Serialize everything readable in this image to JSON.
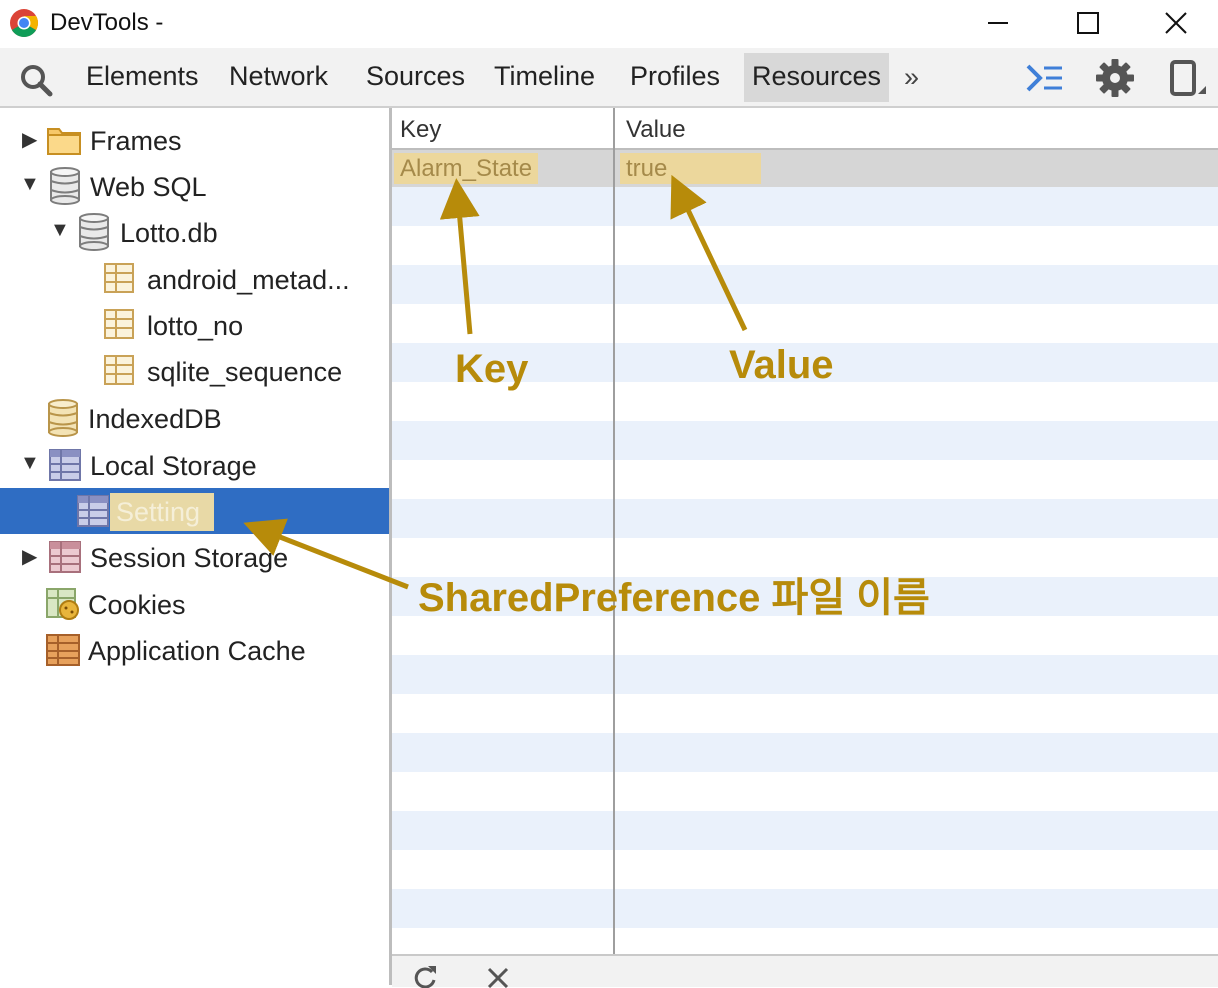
{
  "window": {
    "title": "DevTools -"
  },
  "toolbar": {
    "tabs": [
      "Elements",
      "Network",
      "Sources",
      "Timeline",
      "Profiles",
      "Resources"
    ],
    "active_tab": "Resources",
    "overflow_label": "»"
  },
  "sidebar": {
    "items": [
      {
        "label": "Frames",
        "icon": "folder-icon"
      },
      {
        "label": "Web SQL",
        "icon": "database-icon"
      },
      {
        "label": "Lotto.db",
        "icon": "database-icon"
      },
      {
        "label": "android_metad...",
        "icon": "table-icon"
      },
      {
        "label": "lotto_no",
        "icon": "table-icon"
      },
      {
        "label": "sqlite_sequence",
        "icon": "table-icon"
      },
      {
        "label": "IndexedDB",
        "icon": "database-icon"
      },
      {
        "label": "Local Storage",
        "icon": "storage-grid-icon"
      },
      {
        "label": "Setting",
        "icon": "storage-grid-icon"
      },
      {
        "label": "Session Storage",
        "icon": "storage-grid-icon"
      },
      {
        "label": "Cookies",
        "icon": "cookie-icon"
      },
      {
        "label": "Application Cache",
        "icon": "app-cache-icon"
      }
    ],
    "selected": "Setting"
  },
  "grid": {
    "columns": [
      "Key",
      "Value"
    ],
    "rows": [
      {
        "key": "Alarm_State",
        "value": "true"
      }
    ]
  },
  "annotations": {
    "key": "Key",
    "value": "Value",
    "shared_pref": "SharedPreference 파일 이름"
  },
  "colors": {
    "selection": "#2f6dc3",
    "annotation": "#b78b0a",
    "highlight": "#ecd79c",
    "row_stripe": "#eaf1fb"
  }
}
